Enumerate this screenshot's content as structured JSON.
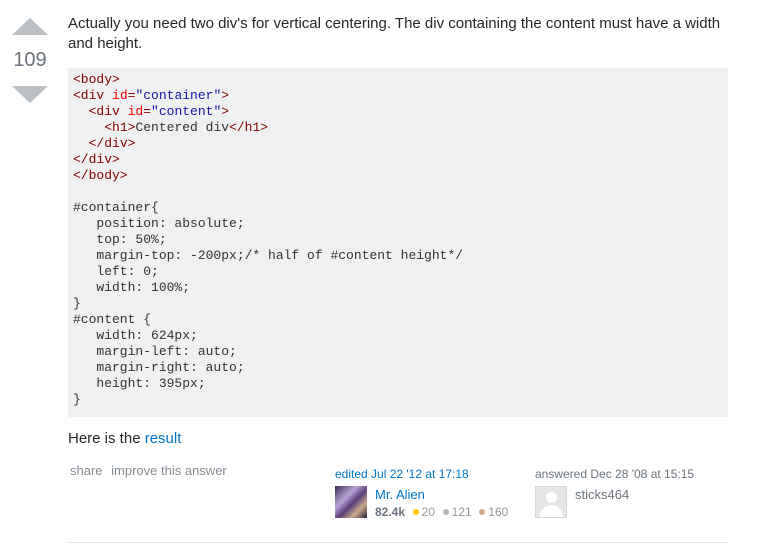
{
  "vote": {
    "count": "109"
  },
  "answer": {
    "intro": "Actually you need two div's for vertical centering. The div containing the content must have a width and height.",
    "code_lines": [
      [
        {
          "t": "<body>",
          "c": "tag"
        }
      ],
      [
        {
          "t": "<div ",
          "c": "tag"
        },
        {
          "t": "id",
          "c": "attr"
        },
        {
          "t": "=",
          "c": "tag"
        },
        {
          "t": "\"container\"",
          "c": "str"
        },
        {
          "t": ">",
          "c": "tag"
        }
      ],
      [
        {
          "t": "  "
        },
        {
          "t": "<div ",
          "c": "tag"
        },
        {
          "t": "id",
          "c": "attr"
        },
        {
          "t": "=",
          "c": "tag"
        },
        {
          "t": "\"content\"",
          "c": "str"
        },
        {
          "t": ">",
          "c": "tag"
        }
      ],
      [
        {
          "t": "    "
        },
        {
          "t": "<h1>",
          "c": "tag"
        },
        {
          "t": "Centered div"
        },
        {
          "t": "</h1>",
          "c": "tag"
        }
      ],
      [
        {
          "t": "  "
        },
        {
          "t": "</div>",
          "c": "tag"
        }
      ],
      [
        {
          "t": "</div>",
          "c": "tag"
        }
      ],
      [
        {
          "t": "</body>",
          "c": "tag"
        }
      ],
      [
        {
          "t": ""
        }
      ],
      [
        {
          "t": "#container{"
        }
      ],
      [
        {
          "t": "   position: absolute;"
        }
      ],
      [
        {
          "t": "   top: 50%;"
        }
      ],
      [
        {
          "t": "   margin-top: -200px;/* half of #content height*/"
        }
      ],
      [
        {
          "t": "   left: 0;"
        }
      ],
      [
        {
          "t": "   width: 100%;"
        }
      ],
      [
        {
          "t": "}"
        }
      ],
      [
        {
          "t": "#content {"
        }
      ],
      [
        {
          "t": "   width: 624px;"
        }
      ],
      [
        {
          "t": "   margin-left: auto;"
        }
      ],
      [
        {
          "t": "   margin-right: auto;"
        }
      ],
      [
        {
          "t": "   height: 395px;"
        }
      ],
      [
        {
          "t": "}"
        }
      ]
    ],
    "result_prefix": "Here is the ",
    "result_link": "result"
  },
  "menu": {
    "share": "share",
    "improve": "improve this answer"
  },
  "editor": {
    "action": "edited Jul 22 '12 at 17:18",
    "name": "Mr. Alien",
    "rep": "82.4k",
    "gold": "20",
    "silver": "121",
    "bronze": "160"
  },
  "owner": {
    "action": "answered Dec 28 '08 at 15:15",
    "name": "sticks464"
  },
  "colors": {
    "gold": "#ffcc01",
    "silver": "#b4b8bc",
    "bronze": "#d1a684"
  }
}
